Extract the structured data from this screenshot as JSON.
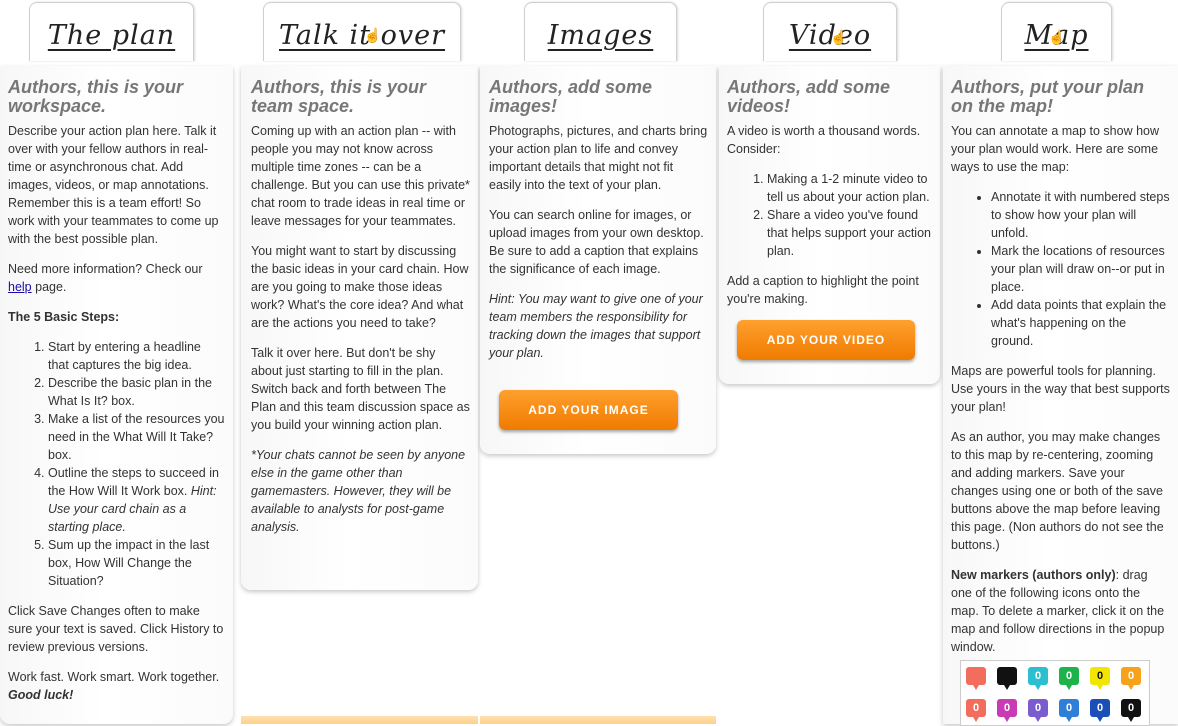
{
  "tabs": [
    {
      "label": "The plan"
    },
    {
      "label": "Talk it over"
    },
    {
      "label": "Images"
    },
    {
      "label": "Video"
    },
    {
      "label": "Map"
    }
  ],
  "plan": {
    "heading": "Authors, this is your workspace.",
    "intro": "Describe your action plan here. Talk it over with your fellow authors in real-time or asynchronous chat. Add images, videos, or map annotations. Remember this is a team effort! So work with your teammates to come up with the best possible plan.",
    "help_prefix": "Need more information? Check our",
    "help_link": "help",
    "help_suffix": "page.",
    "steps_title": "The 5 Basic Steps:",
    "steps": [
      "Start by entering a headline that captures the big idea.",
      "Describe the basic plan in the What Is It? box.",
      "Make a list of the resources you need in the What Will It Take? box.",
      "Outline the steps to succeed in the How Will It Work box.",
      "Sum up the impact in the last box, How Will Change the Situation?"
    ],
    "step4_hint": "Hint: Use your card chain as a starting place.",
    "save_note": "Click Save Changes often to make sure your text is saved. Click History to review previous versions.",
    "closing": "Work fast. Work smart. Work together.",
    "good_luck": "Good luck!"
  },
  "talk": {
    "heading": "Authors, this is your team space.",
    "p1": "Coming up with an action plan -- with people you may not know across multiple time zones -- can be a challenge. But you can use this private* chat room to trade ideas in real time or leave messages for your teammates.",
    "p2": "You might want to start by discussing the basic ideas in your card chain. How are you going to make those ideas work? What's the core idea? And what are the actions you need to take?",
    "p3": "Talk it over here. But don't be shy about just starting to fill in the plan. Switch back and forth between The Plan and this team discussion space as you build your winning action plan.",
    "note": "*Your chats cannot be seen by anyone else in the game other than gamemasters. However, they will be available to analysts for post-game analysis."
  },
  "images": {
    "heading": "Authors, add some images!",
    "p1": "Photographs, pictures, and charts bring your action plan to life and convey important details that might not fit easily into the text of your plan.",
    "p2": "You can search online for images, or upload images from your own desktop. Be sure to add a caption that explains the significance of each image.",
    "hint": "Hint: You may want to give one of your team members the responsibility for tracking down the images that support your plan.",
    "button": "ADD YOUR IMAGE"
  },
  "video": {
    "heading": "Authors, add some videos!",
    "p1": "A video is worth a thousand words. Consider:",
    "items": [
      "Making a 1-2 minute video to tell us about your action plan.",
      "Share a video you've found that helps support your action plan."
    ],
    "p2": "Add a caption to highlight the point you're making.",
    "button": "ADD YOUR VIDEO"
  },
  "map": {
    "heading": "Authors, put your plan on the map!",
    "p1": "You can annotate a map to show how your plan would work. Here are some ways to use the map:",
    "items": [
      "Annotate it with numbered steps to show how your plan will unfold.",
      "Mark the locations of resources your plan will draw on--or put in place.",
      "Add data points that explain the what's happening on the ground."
    ],
    "p2": "Maps are powerful tools for planning. Use yours in the way that best supports your plan!",
    "p3": "As an author, you may make changes to this map by re-centering, zooming and adding markers. Save your changes using one or both of the save buttons above the map before leaving this page. (Non authors do not see the buttons.)",
    "markers_label": "New markers (authors only)",
    "markers_text": ": drag one of the following icons onto the map. To delete a marker, click it on the map and follow directions in the popup window.",
    "markers": [
      {
        "color": "#f26d5b",
        "label": ""
      },
      {
        "color": "#111111",
        "label": ""
      },
      {
        "color": "#2bbfcf",
        "label": "0"
      },
      {
        "color": "#1db34a",
        "label": "0"
      },
      {
        "color": "#f2e600",
        "label": "0"
      },
      {
        "color": "#f7a21b",
        "label": "0"
      },
      {
        "color": "#f26d5b",
        "label": "0"
      },
      {
        "color": "#c93bb5",
        "label": "0"
      },
      {
        "color": "#7a5ccf",
        "label": "0"
      },
      {
        "color": "#2f7fd8",
        "label": "0"
      },
      {
        "color": "#1a4fb8",
        "label": "0"
      },
      {
        "color": "#111111",
        "label": "0"
      }
    ]
  }
}
